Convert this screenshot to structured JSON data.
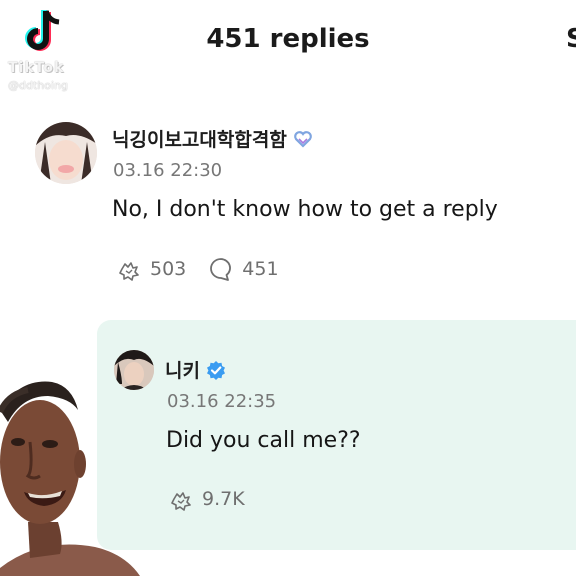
{
  "watermark": {
    "logo_icon": "tiktok-logo-icon",
    "name": "TikTok",
    "handle": "@ddthoing"
  },
  "header": {
    "title": "451 replies",
    "partial": "S"
  },
  "comment": {
    "author": "닉깅이보고대학합격함",
    "badge_icon": "heart-badge-icon",
    "timestamp": "03.16 22:30",
    "text": "No, I don't know how to get a reply",
    "like_icon": "like-paw-icon",
    "likes": "503",
    "reply_icon": "speech-bubble-icon",
    "replies": "451"
  },
  "reply": {
    "author": "니키",
    "badge_icon": "verified-check-icon",
    "timestamp": "03.16 22:35",
    "text": "Did you call me??",
    "like_icon": "like-paw-icon",
    "likes": "9.7K",
    "highlight_color": "#e8f6f1"
  },
  "colors": {
    "accent_badge": "#7fa5e0",
    "verified": "#3a9cf1",
    "muted": "#777777"
  }
}
